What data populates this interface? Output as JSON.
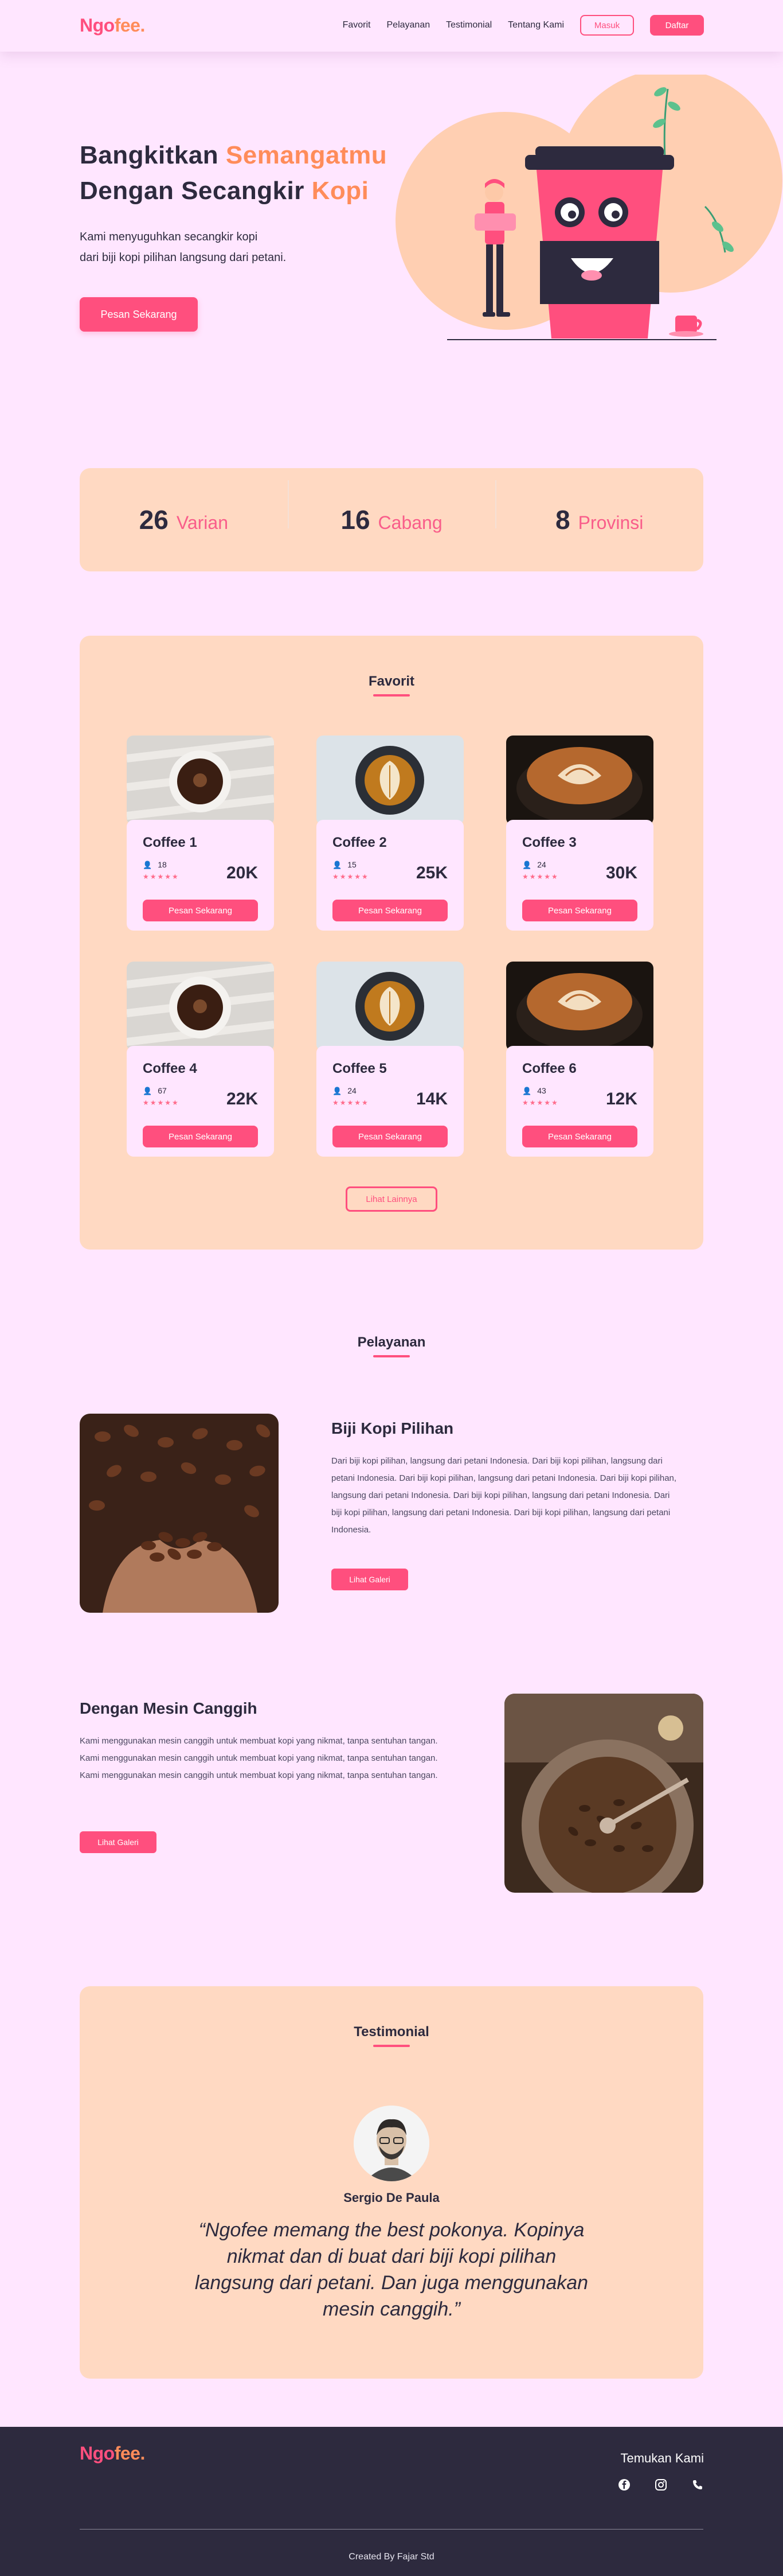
{
  "brand": {
    "part1": "Ngo",
    "part2": "fee."
  },
  "nav": {
    "links": [
      "Favorit",
      "Pelayanan",
      "Testimonial",
      "Tentang Kami"
    ],
    "login": "Masuk",
    "register": "Daftar"
  },
  "hero": {
    "line1_plain": "Bangkitkan ",
    "line1_accent": "Semangatmu",
    "line2_plain": "Dengan Secangkir ",
    "line2_accent": "Kopi",
    "desc_line1": "Kami menyuguhkan secangkir kopi",
    "desc_line2": "dari biji kopi pilihan langsung dari petani.",
    "cta": "Pesan Sekarang"
  },
  "stats": [
    {
      "value": "26",
      "label": "Varian"
    },
    {
      "value": "16",
      "label": "Cabang"
    },
    {
      "value": "8",
      "label": "Provinsi"
    }
  ],
  "favorit": {
    "title": "Favorit",
    "products": [
      {
        "name": "Coffee 1",
        "likes": "18",
        "price": "20K",
        "button": "Pesan Sekarang"
      },
      {
        "name": "Coffee 2",
        "likes": "15",
        "price": "25K",
        "button": "Pesan Sekarang"
      },
      {
        "name": "Coffee 3",
        "likes": "24",
        "price": "30K",
        "button": "Pesan Sekarang"
      },
      {
        "name": "Coffee 4",
        "likes": "67",
        "price": "22K",
        "button": "Pesan Sekarang"
      },
      {
        "name": "Coffee 5",
        "likes": "24",
        "price": "14K",
        "button": "Pesan Sekarang"
      },
      {
        "name": "Coffee 6",
        "likes": "43",
        "price": "12K",
        "button": "Pesan Sekarang"
      }
    ],
    "rating_stars": "★★★★★",
    "more": "Lihat Lainnya"
  },
  "pelayanan": {
    "title": "Pelayanan",
    "items": [
      {
        "title": "Biji Kopi Pilihan",
        "desc": "Dari biji kopi pilihan, langsung dari petani Indonesia. Dari biji kopi pilihan, langsung dari petani Indonesia. Dari biji kopi pilihan, langsung dari petani Indonesia. Dari biji kopi pilihan, langsung dari petani Indonesia. Dari biji kopi pilihan, langsung dari petani Indonesia. Dari biji kopi pilihan, langsung dari petani Indonesia. Dari biji kopi pilihan, langsung dari petani Indonesia.",
        "button": "Lihat Galeri"
      },
      {
        "title": "Dengan Mesin Canggih",
        "desc": "Kami menggunakan mesin canggih untuk membuat kopi yang nikmat, tanpa sentuhan tangan.  Kami menggunakan mesin canggih untuk membuat kopi yang nikmat, tanpa sentuhan tangan.  Kami menggunakan mesin canggih untuk membuat kopi yang nikmat, tanpa sentuhan tangan.",
        "button": "Lihat Galeri"
      }
    ]
  },
  "testimonial": {
    "title": "Testimonial",
    "name": "Sergio De Paula",
    "quote": "“Ngofee memang the best pokonya. Kopinya nikmat dan di buat dari biji kopi pilihan langsung dari petani. Dan juga menggunakan mesin canggih.”"
  },
  "footer": {
    "find_us": "Temukan Kami",
    "social_icons": [
      "facebook-icon",
      "instagram-icon",
      "phone-icon"
    ],
    "credit": "Created By Fajar Std"
  },
  "colors": {
    "background": "#FFE6FF",
    "primary": "#FF4F7E",
    "accent_orange": "#FF8C5A",
    "panel": "#FFD9C2",
    "dark": "#2D2A3E"
  }
}
